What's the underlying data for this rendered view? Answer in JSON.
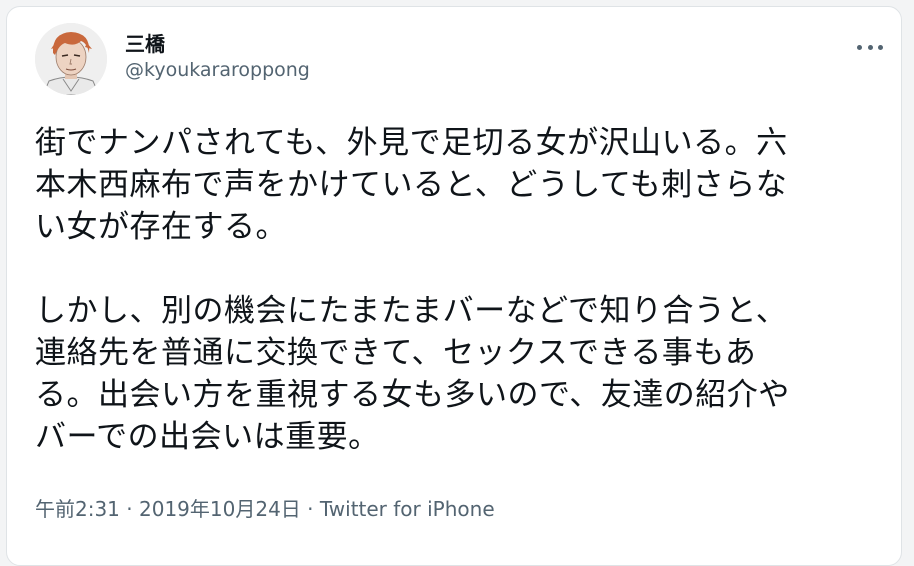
{
  "user": {
    "display_name": "三橋",
    "handle": "@kyoukararoppong"
  },
  "tweet": {
    "paragraph_1": [
      "街でナンパされても、外見で足切る女が沢山いる。六",
      "本木西麻布で声をかけていると、どうしても刺さらな",
      "い女が存在する。"
    ],
    "paragraph_2": [
      "しかし、別の機会にたまたまバーなどで知り合うと、",
      "連絡先を普通に交換できて、セックスできる事もあ",
      "る。出会い方を重視する女も多いので、友達の紹介や",
      "バーでの出会いは重要。"
    ]
  },
  "meta": {
    "time": "午前2:31",
    "separator": " · ",
    "date": "2019年10月24日",
    "source": "Twitter for iPhone"
  },
  "icons": {
    "more": "more-horizontal-icon"
  },
  "colors": {
    "text": "#0f1419",
    "secondary": "#536471",
    "border": "#dfe3e6"
  }
}
